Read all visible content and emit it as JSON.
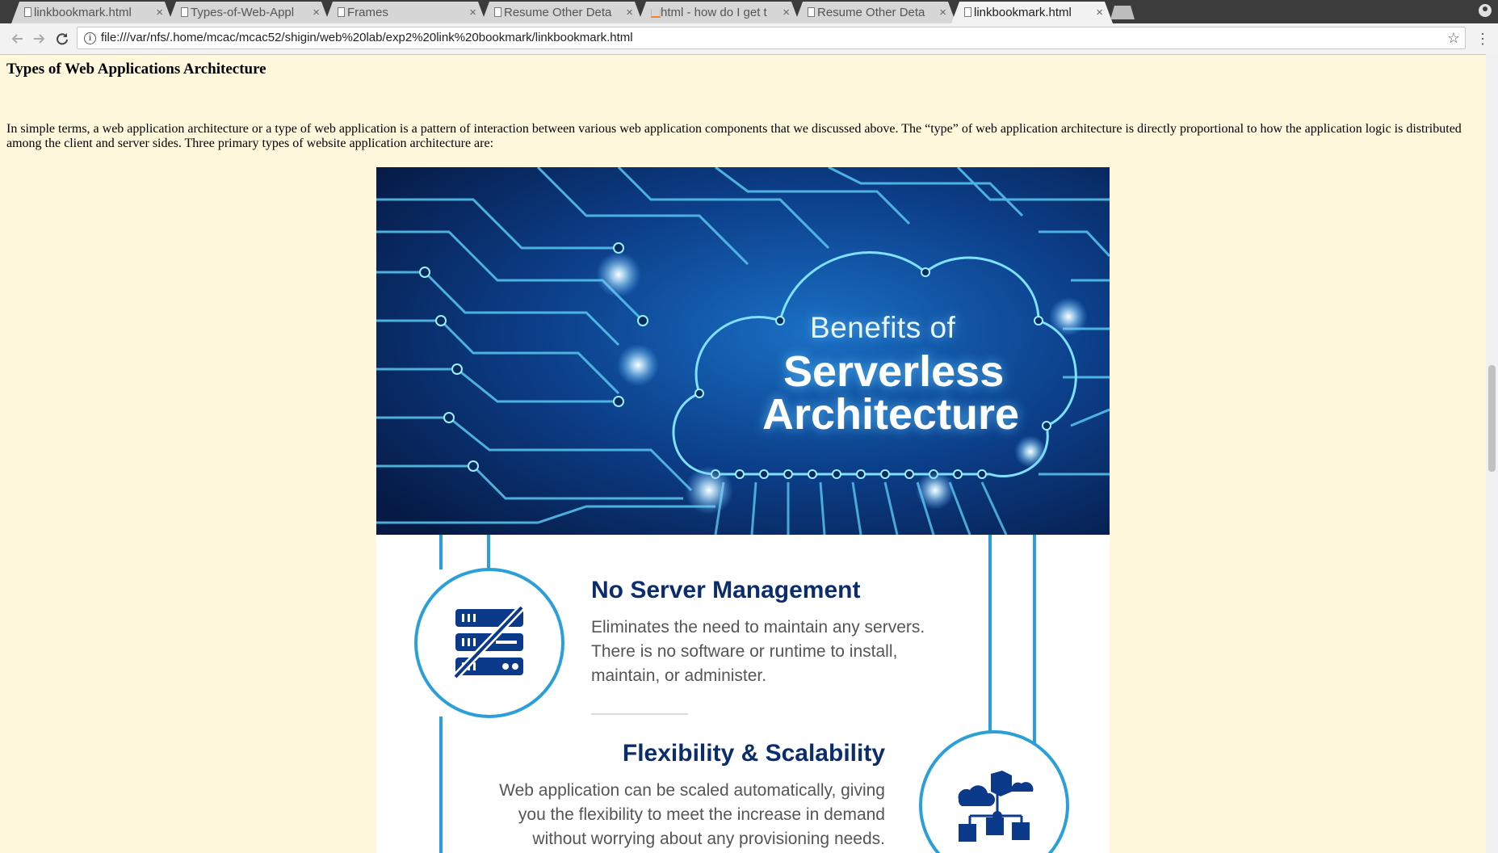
{
  "browser": {
    "tabs": [
      {
        "label": "linkbookmark.html",
        "favicon": "page-icon",
        "active": false
      },
      {
        "label": "Types-of-Web-Appl",
        "favicon": "page-icon",
        "active": false
      },
      {
        "label": "Frames",
        "favicon": "page-icon",
        "active": false
      },
      {
        "label": "Resume Other Deta",
        "favicon": "page-icon",
        "active": false
      },
      {
        "label": "html - how do I get t",
        "favicon": "stackoverflow-icon",
        "active": false
      },
      {
        "label": "Resume Other Deta",
        "favicon": "page-icon",
        "active": false
      },
      {
        "label": "linkbookmark.html",
        "favicon": "page-icon",
        "active": true
      }
    ],
    "tab_close_glyph": "×",
    "url": "file:///var/nfs/.home/mcac/mcac52/shigin/web%20lab/exp2%20link%20bookmark/linkbookmark.html"
  },
  "page": {
    "heading": "Types of Web Applications Architecture",
    "intro": "In simple terms, a web application architecture or a type of web application is a pattern of interaction between various web application components that we discussed above. The “type” of web application architecture is directly proportional to how the application logic is distributed among the client and server sides. Three primary types of website application architecture are:",
    "infographic": {
      "banner_line1": "Benefits of",
      "banner_line2": "Serverless",
      "banner_line3": "Architecture",
      "features": [
        {
          "title": "No Server Management",
          "desc_lines": [
            "Eliminates the need to maintain any servers.",
            "There is no software or runtime to install,",
            "maintain, or administer."
          ],
          "icon": "server-crossed-icon"
        },
        {
          "title": "Flexibility & Scalability",
          "desc_lines": [
            "Web application can be scaled automatically, giving",
            "you the flexibility to meet the increase in demand",
            "without worrying about any provisioning needs."
          ],
          "icon": "cloud-network-icon"
        }
      ]
    }
  },
  "colors": {
    "page_bg": "#fff8dc",
    "accent_blue": "#2a9fd8",
    "title_navy": "#0b2d6e"
  }
}
